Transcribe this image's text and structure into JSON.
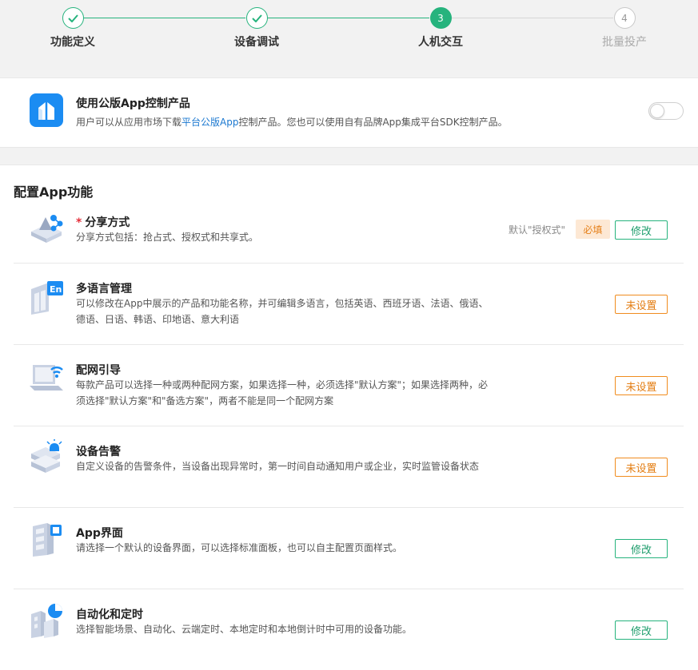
{
  "steps": [
    {
      "label": "功能定义",
      "state": "done",
      "mark": "✓"
    },
    {
      "label": "设备调试",
      "state": "done",
      "mark": "✓"
    },
    {
      "label": "人机交互",
      "state": "active",
      "mark": "3"
    },
    {
      "label": "批量投产",
      "state": "todo",
      "mark": "4"
    }
  ],
  "public_app": {
    "title": "使用公版App控制产品",
    "desc_before": "用户可以从应用市场下载",
    "desc_link": "平台公版App",
    "desc_after": "控制产品。您也可以使用自有品牌App集成平台SDK控制产品。",
    "toggle_on": false
  },
  "config": {
    "title": "配置App功能",
    "items": [
      {
        "title": "分享方式",
        "required_mark": "*",
        "desc": "分享方式包括：抢占式、授权式和共享式。",
        "default_text": "默认\"授权式\"",
        "badge": "必填",
        "button": "修改",
        "icon": "share-icon"
      },
      {
        "title": "多语言管理",
        "desc": "可以修改在App中展示的产品和功能名称，并可编辑多语言，包括英语、西班牙语、法语、俄语、德语、日语、韩语、印地语、意大利语",
        "button": "未设置",
        "icon": "language-icon"
      },
      {
        "title": "配网引导",
        "desc": "每款产品可以选择一种或两种配网方案，如果选择一种，必须选择\"默认方案\"；如果选择两种，必须选择\"默认方案\"和\"备选方案\"，两者不能是同一个配网方案",
        "button": "未设置",
        "icon": "wifi-laptop-icon"
      },
      {
        "title": "设备告警",
        "desc": "自定义设备的告警条件，当设备出现异常时，第一时间自动通知用户或企业，实时监管设备状态",
        "button": "未设置",
        "icon": "alarm-icon"
      },
      {
        "title": "App界面",
        "desc": "请选择一个默认的设备界面，可以选择标准面板，也可以自主配置页面样式。",
        "button": "修改",
        "icon": "app-panel-icon"
      },
      {
        "title": "自动化和定时",
        "desc": "选择智能场景、自动化、云端定时、本地定时和本地倒计时中可用的设备功能。",
        "button": "修改",
        "icon": "automation-icon"
      }
    ]
  },
  "colors": {
    "accent": "#26b37d",
    "warning": "#f08c1e",
    "link": "#1b78d0",
    "brand_blue": "#1b8cf2"
  }
}
